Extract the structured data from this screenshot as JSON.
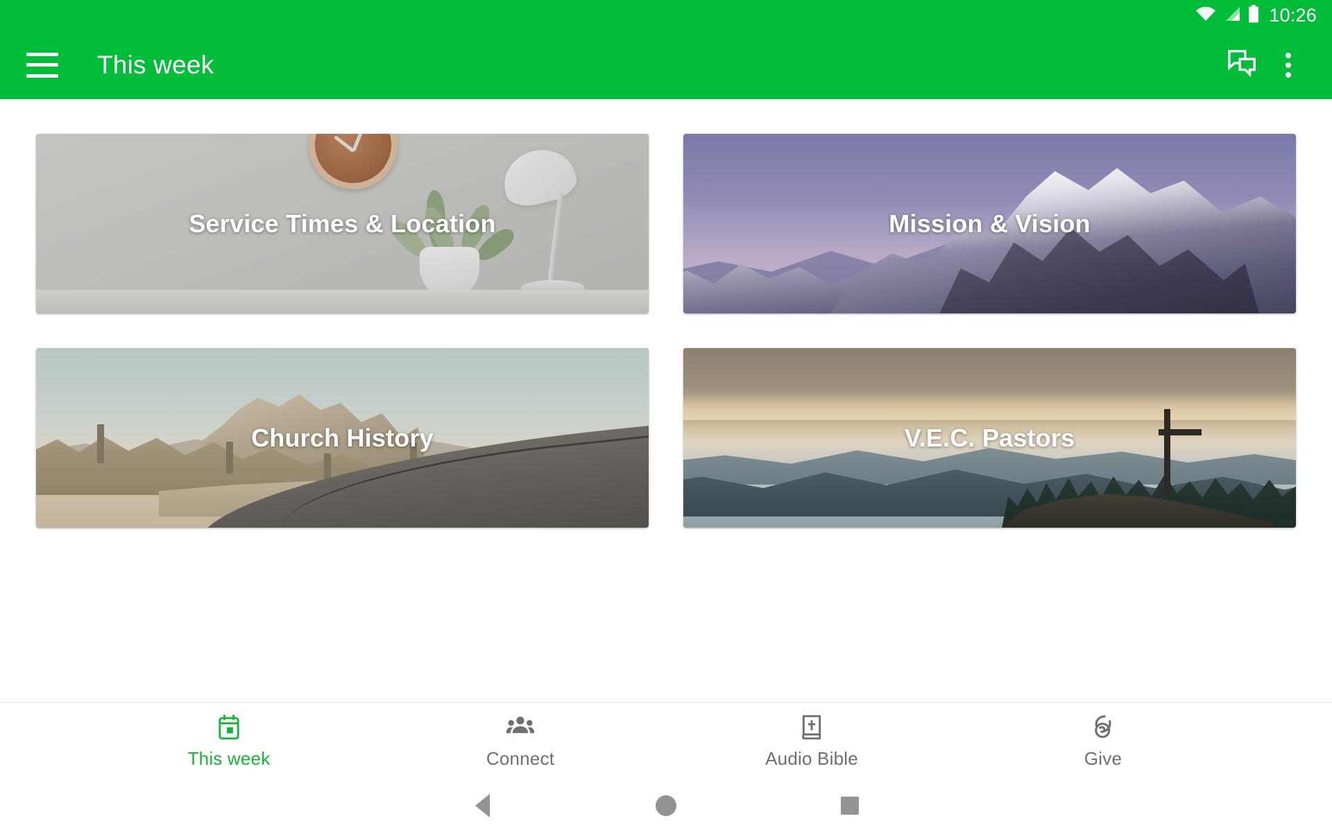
{
  "statusbar": {
    "time": "10:26",
    "icons": [
      "wifi-icon",
      "cell-signal-icon",
      "battery-icon"
    ]
  },
  "appbar": {
    "menu_icon": "hamburger-menu-icon",
    "title": "This week",
    "actions": [
      {
        "icon": "chat-bubbles-icon",
        "name": "messages-button"
      },
      {
        "icon": "overflow-menu-icon",
        "name": "more-options-button"
      }
    ],
    "background_color": "#00BD39"
  },
  "main": {
    "cards": [
      {
        "title": "Service Times & Location",
        "image_description": "white interior wall with wooden clock, desk lamp and potted plant"
      },
      {
        "title": "Mission & Vision",
        "image_description": "snow covered rocky mountain peaks under purple dusk sky"
      },
      {
        "title": "Church History",
        "image_description": "desert landscape with rocky butte and winding empty road"
      },
      {
        "title": "V.E.C. Pastors",
        "image_description": "sunset over forested valley with silhouetted cross on hilltop"
      }
    ]
  },
  "bottom_nav": {
    "active_color": "#18B33A",
    "inactive_color": "#6F6F6F",
    "items": [
      {
        "label": "This week",
        "icon": "calendar-icon",
        "active": true
      },
      {
        "label": "Connect",
        "icon": "people-group-icon",
        "active": false
      },
      {
        "label": "Audio Bible",
        "icon": "bible-book-icon",
        "active": false
      },
      {
        "label": "Give",
        "icon": "giving-hand-icon",
        "active": false
      }
    ]
  },
  "system_nav": {
    "buttons": [
      {
        "name": "back-button",
        "icon": "triangle-back-icon"
      },
      {
        "name": "home-button",
        "icon": "circle-home-icon"
      },
      {
        "name": "recents-button",
        "icon": "square-recents-icon"
      }
    ]
  }
}
